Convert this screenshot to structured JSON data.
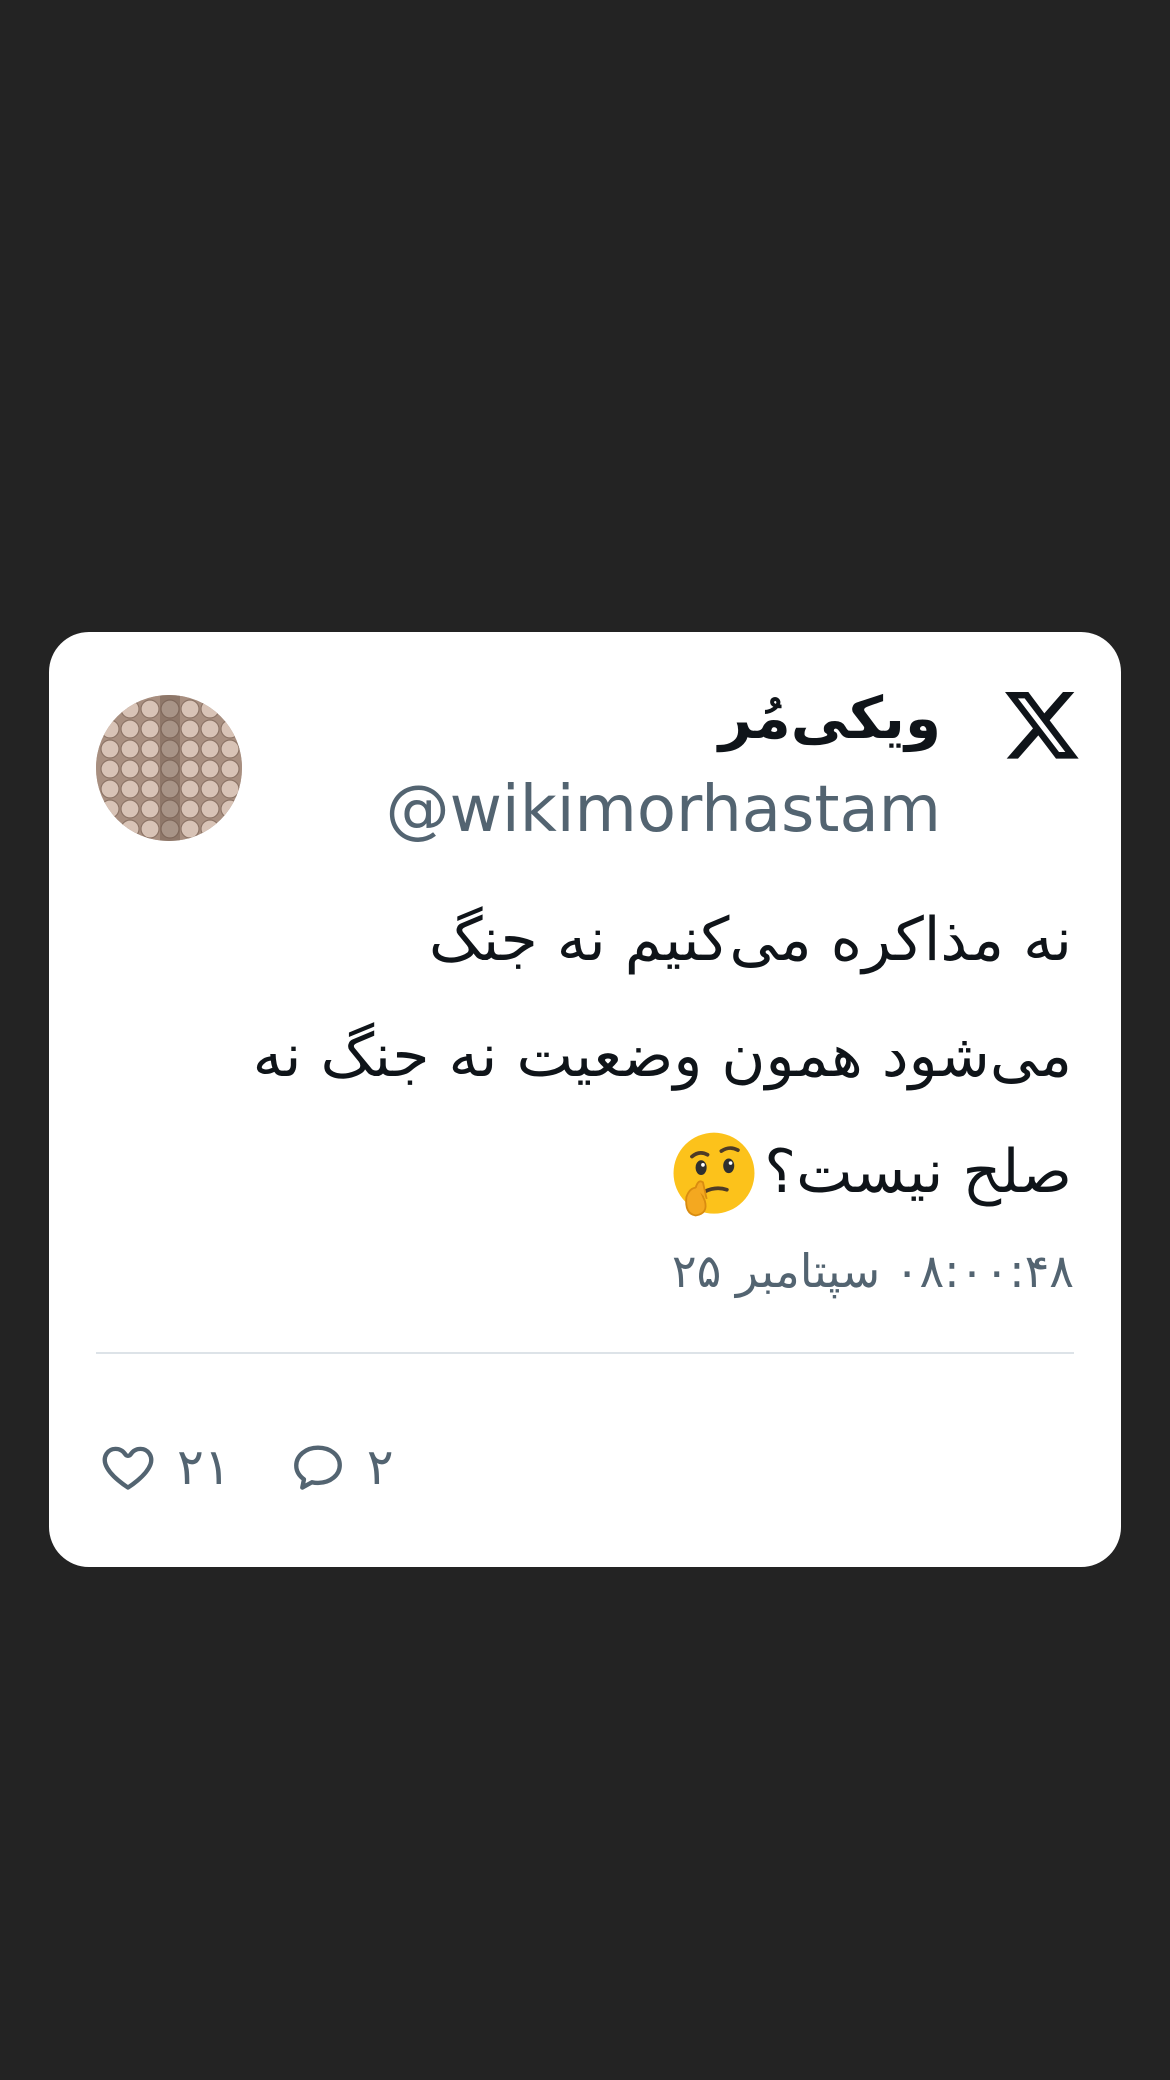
{
  "tweet": {
    "display_name": "ویکی‌مُر",
    "handle": "@wikimorhastam",
    "text_lines": [
      "نه مذاکره می‌کنیم نه جنگ",
      "می‌شود همون وضعیت نه جنگ نه",
      "صلح نیست؟"
    ],
    "emoji": "thinking-face",
    "timestamp": "۰۸:۰۰:۴۸ سپتامبر ۲۵",
    "likes_count": "۲۱",
    "replies_count": "۲",
    "platform_icon": "x-logo-icon",
    "colors": {
      "background": "#232323",
      "card": "#ffffff",
      "text": "#0f1419",
      "secondary": "#536471",
      "divider": "#dde3e8"
    }
  }
}
